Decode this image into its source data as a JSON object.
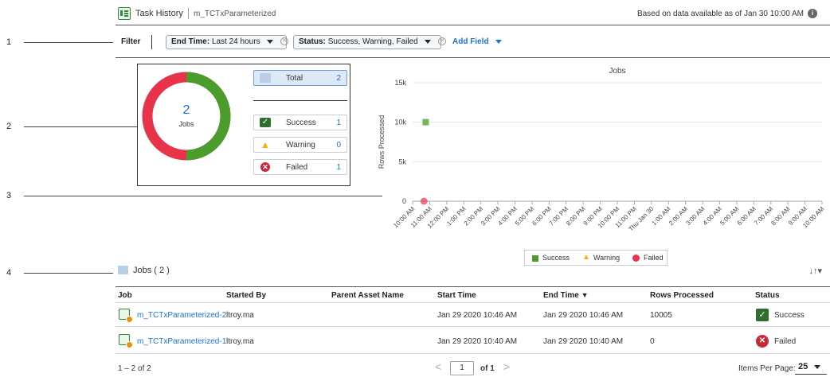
{
  "header": {
    "title": "Task History",
    "subtitle": "m_TCTxParameterized",
    "data_note": "Based on data available as of Jan 30 10:00 AM"
  },
  "callouts": [
    "1",
    "2",
    "3",
    "4"
  ],
  "filter": {
    "label": "Filter",
    "chips": [
      {
        "key": "End Time:",
        "value": "Last 24 hours"
      },
      {
        "key": "Status:",
        "value": "Success, Warning, Failed"
      }
    ],
    "add_field": "Add Field"
  },
  "summary": {
    "donut_count": "2",
    "donut_label": "Jobs",
    "total_label": "Total",
    "total_count": "2",
    "items": [
      {
        "label": "Success",
        "count": "1"
      },
      {
        "label": "Warning",
        "count": "0"
      },
      {
        "label": "Failed",
        "count": "1"
      }
    ],
    "colors": {
      "success": "#4a9c2d",
      "failed": "#e8334a",
      "warning": "#f1b300"
    }
  },
  "chart_data": {
    "type": "scatter",
    "title": "Jobs",
    "ylabel": "Rows Processed",
    "xlabel": "",
    "ylim": [
      0,
      15000
    ],
    "yticks": [
      "0",
      "5k",
      "10k",
      "15k"
    ],
    "categories": [
      "10:00 AM",
      "11:00 AM",
      "12:00 PM",
      "1:00 PM",
      "2:00 PM",
      "3:00 PM",
      "4:00 PM",
      "5:00 PM",
      "6:00 PM",
      "7:00 PM",
      "8:00 PM",
      "9:00 PM",
      "10:00 PM",
      "11:00 PM",
      "Thu Jan 30",
      "1:00 AM",
      "2:00 AM",
      "3:00 AM",
      "4:00 AM",
      "5:00 AM",
      "6:00 AM",
      "7:00 AM",
      "8:00 AM",
      "9:00 AM",
      "10:00 AM"
    ],
    "series": [
      {
        "name": "Success",
        "color": "#77b75c",
        "marker": "square",
        "points": [
          {
            "x": "Jan 29 2020 10:46 AM",
            "y": 10005
          }
        ]
      },
      {
        "name": "Warning",
        "color": "#f1b300",
        "marker": "triangle",
        "points": []
      },
      {
        "name": "Failed",
        "color": "#e8334a",
        "marker": "circle",
        "points": [
          {
            "x": "Jan 29 2020 10:40 AM",
            "y": 0
          }
        ]
      }
    ],
    "legend": "bottom"
  },
  "jobs": {
    "title": "Jobs ( 2 )",
    "columns": [
      "Job",
      "Started By",
      "Parent Asset Name",
      "Start Time",
      "End Time",
      "Rows Processed",
      "Status"
    ],
    "rows": [
      {
        "job": "m_TCTxParameterized-2",
        "started_by": "ltroy.ma",
        "parent": "",
        "start": "Jan 29 2020 10:46 AM",
        "end": "Jan 29 2020 10:46 AM",
        "rows": "10005",
        "status": "Success"
      },
      {
        "job": "m_TCTxParameterized-1",
        "started_by": "ltroy.ma",
        "parent": "",
        "start": "Jan 29 2020 10:40 AM",
        "end": "Jan 29 2020 10:40 AM",
        "rows": "0",
        "status": "Failed"
      }
    ]
  },
  "pager": {
    "range": "1 – 2 of 2",
    "page": "1",
    "of": "of 1",
    "items_label": "Items Per Page:",
    "items_value": "25"
  }
}
